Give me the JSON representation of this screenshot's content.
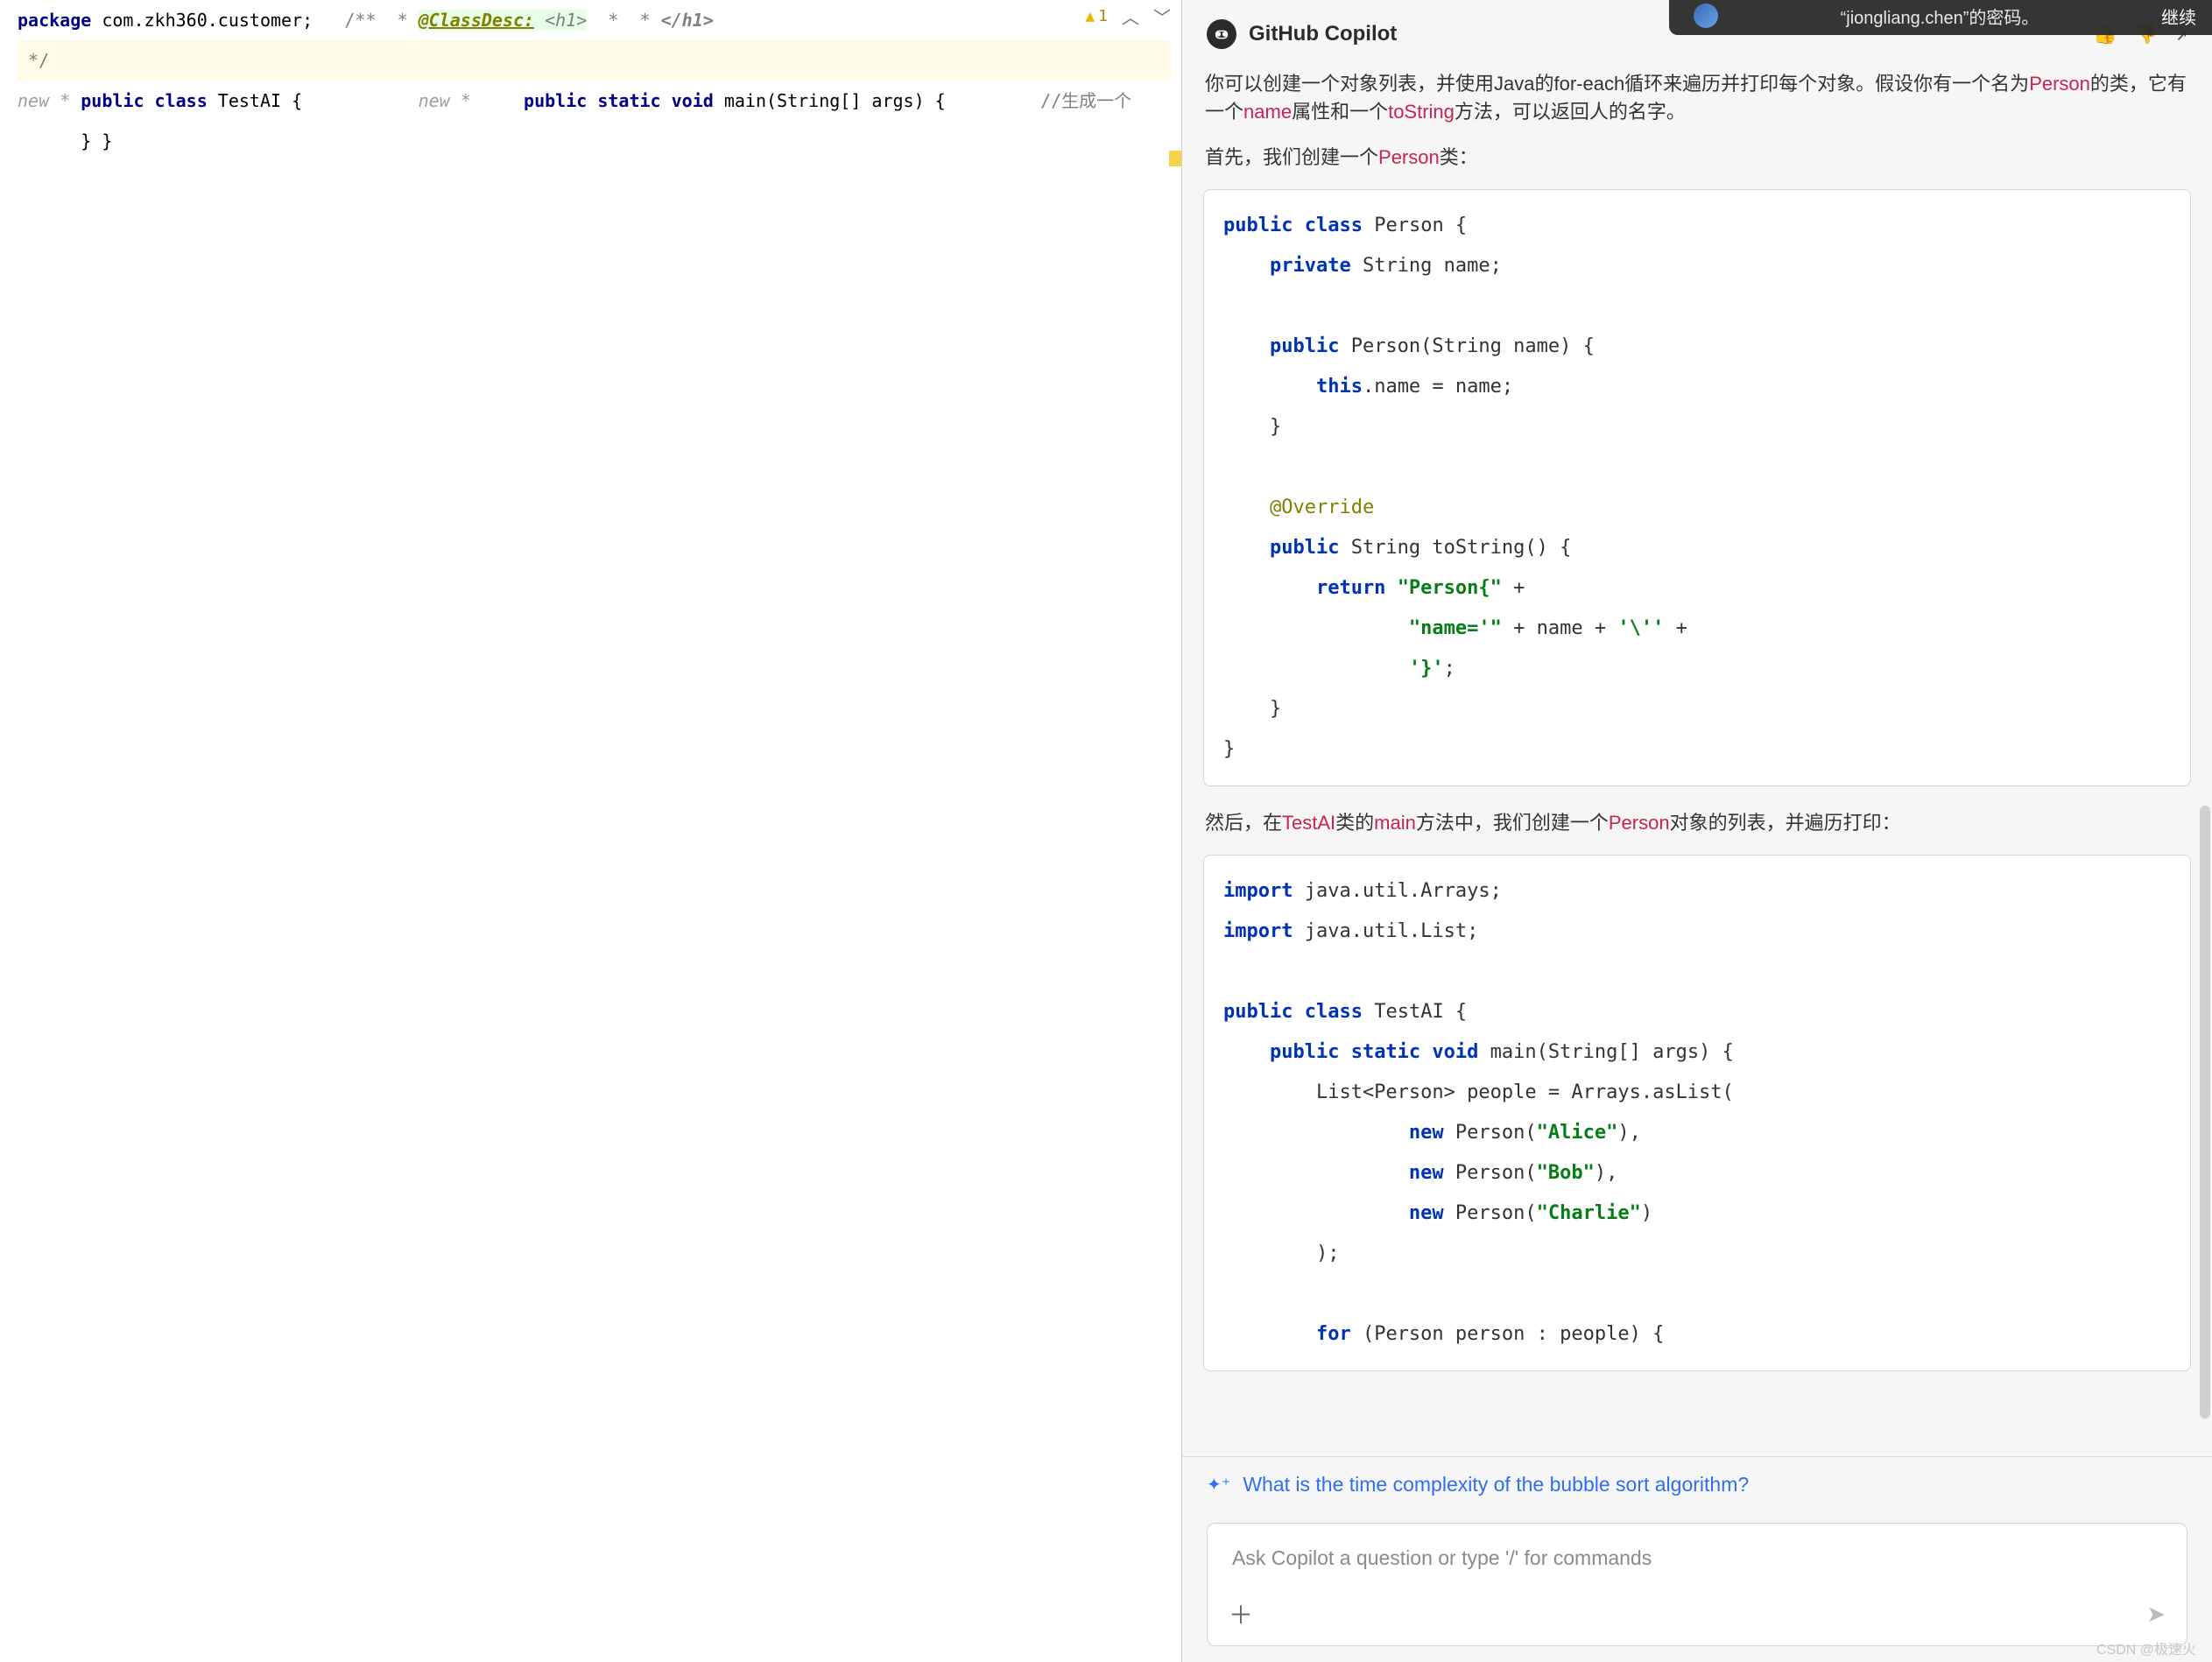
{
  "notification": {
    "text": "“jiongliang.chen”的密码。",
    "action": "继续"
  },
  "editor": {
    "warning_count": "1",
    "package_kw": "package",
    "package_name": " com.zkh360.customer;",
    "doc_open": "/**",
    "doc_star": " * ",
    "classdesc": "@ClassDesc:",
    "h1_open": " <h1>",
    "doc_star2": " *",
    "doc_star3": " * ",
    "h1_close": "</h1>",
    "doc_close": " */",
    "hint_new1": "new *",
    "public_kw": "public",
    "class_kw": " class",
    "class_name": " TestAI {",
    "hint_new2": "new *",
    "static_kw": " static",
    "void_kw": " void",
    "main_sig": " main(String[] args) {",
    "comment_cn": "//生成一个",
    "brace_close1": "}",
    "brace_close2": "}"
  },
  "copilot": {
    "title": "GitHub Copilot",
    "p1_a": "你可以创建一个对象列表，并使用Java的for-each循环来遍历并打印每个对象。假设你有一个名为",
    "p1_person": "Person",
    "p1_b": "的类，它有一个",
    "p1_name": "name",
    "p1_c": "属性和一个",
    "p1_tostring": "toString",
    "p1_d": "方法，可以返回人的名字。",
    "p2_a": "首先，我们创建一个",
    "p2_person": "Person",
    "p2_b": "类：",
    "code1": {
      "l1_public": "public",
      "l1_class": " class",
      "l1_rest": " Person {",
      "l2_private": "    private",
      "l2_rest": " String name;",
      "blank": "",
      "l3_public": "    public",
      "l3_rest": " Person(String name) {",
      "l4_this": "        this",
      "l4_rest": ".name = name;",
      "l5": "    }",
      "l6_ann": "    @Override",
      "l7_public": "    public",
      "l7_rest": " String toString() {",
      "l8_return": "        return ",
      "l8_s1": "\"Person{\"",
      "l8_plus": " +",
      "l9_s": "                \"name='\"",
      "l9_mid": " + name + ",
      "l9_s2": "'\\''",
      "l9_plus": " +",
      "l10_s": "                '}'",
      "l10_end": ";",
      "l11": "    }",
      "l12": "}"
    },
    "p3_a": "然后，在",
    "p3_testai": "TestAI",
    "p3_b": "类的",
    "p3_main": "main",
    "p3_c": "方法中，我们创建一个",
    "p3_person": "Person",
    "p3_d": "对象的列表，并遍历打印：",
    "code2": {
      "l1_import": "import",
      "l1_rest": " java.util.Arrays;",
      "l2_import": "import",
      "l2_rest": " java.util.List;",
      "blank": "",
      "l3_public": "public",
      "l3_class": " class",
      "l3_rest": " TestAI {",
      "l4_public": "    public",
      "l4_static": " static",
      "l4_void": " void",
      "l4_rest": " main(String[] args) {",
      "l5": "        List<Person> people = Arrays.asList(",
      "l6_new": "                new",
      "l6_rest": " Person(",
      "l6_s": "\"Alice\"",
      "l6_end": "),",
      "l7_new": "                new",
      "l7_rest": " Person(",
      "l7_s": "\"Bob\"",
      "l7_end": "),",
      "l8_new": "                new",
      "l8_rest": " Person(",
      "l8_s": "\"Charlie\"",
      "l8_end": ")",
      "l9": "        );",
      "l10_for": "        for",
      "l10_rest": " (Person person : people) {"
    },
    "suggestion": "What is the time complexity of the bubble sort algorithm?",
    "ask_placeholder": "Ask Copilot a question or type '/' for commands",
    "watermark": "CSDN @极速火"
  }
}
